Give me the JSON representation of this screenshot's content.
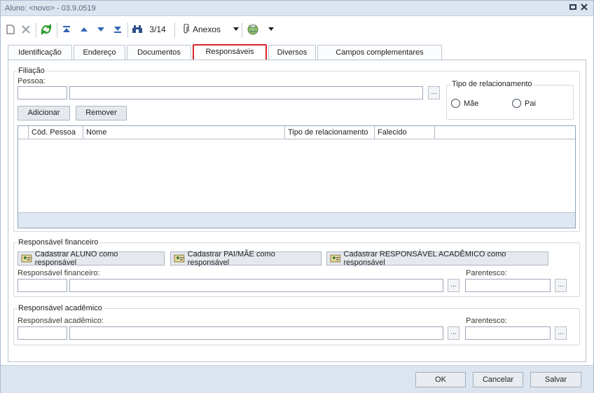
{
  "window": {
    "title": "Aluno: <novo> - 03.9.0519"
  },
  "toolbar": {
    "record_counter": "3/14",
    "anexos_label": "Anexos"
  },
  "tabs": [
    {
      "label": "Identificação",
      "active": false
    },
    {
      "label": "Endereço",
      "active": false
    },
    {
      "label": "Documentos",
      "active": false
    },
    {
      "label": "Responsáveis",
      "active": true
    },
    {
      "label": "Diversos",
      "active": false
    },
    {
      "label": "Campos complementares",
      "active": false
    }
  ],
  "filiacao": {
    "legend": "Filiação",
    "pessoa_label": "Pessoa:",
    "pessoa_code": "",
    "pessoa_name": "",
    "ellipsis": "...",
    "add_button": "Adicionar",
    "remove_button": "Remover",
    "relationship_legend": "Tipo de relacionamento",
    "radio_mother": "Mãe",
    "radio_father": "Pai",
    "grid_columns": [
      "Cód. Pessoa",
      "Nome",
      "Tipo de relacionamento",
      "Falecido"
    ]
  },
  "financeiro": {
    "legend": "Responsável financeiro",
    "btn_aluno": "Cadastrar ALUNO como responsável",
    "btn_pai_mae": "Cadastrar PAI/MÃE como responsável",
    "btn_academico": "Cadastrar RESPONSÁVEL ACADÊMICO como responsável",
    "field_label": "Responsável financeiro:",
    "parentesco_label": "Parentesco:",
    "ellipsis": "..."
  },
  "academico": {
    "legend": "Responsável acadêmico",
    "field_label": "Responsável acadêmico:",
    "parentesco_label": "Parentesco:",
    "ellipsis": "..."
  },
  "footer": {
    "ok": "OK",
    "cancel": "Cancelar",
    "save": "Salvar"
  },
  "colors": {
    "title_bar": "#dbe4ef",
    "active_tab_highlight": "#d9262b",
    "grid_footer": "#dfe7f2"
  }
}
